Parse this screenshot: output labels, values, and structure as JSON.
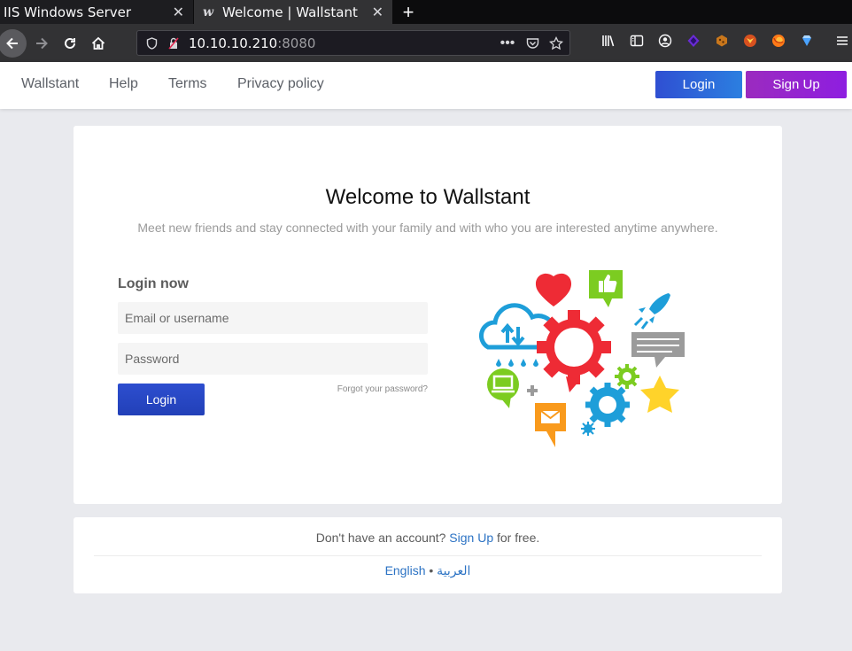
{
  "browser": {
    "tabs": [
      {
        "title": "IIS Windows Server",
        "favicon": ""
      },
      {
        "title": "Welcome | Wallstant",
        "favicon": "w"
      }
    ],
    "new_tab_label": "+",
    "url_host": "10.10.10.210",
    "url_port": ":8080",
    "toolbar_icons": [
      "library-icon",
      "sidebar-icon",
      "account-icon",
      "extension-purple-icon",
      "extension-cookie-icon",
      "extension-fox-icon",
      "firefox-icon",
      "extension-diamond-icon",
      "menu-icon"
    ]
  },
  "site": {
    "nav": [
      "Wallstant",
      "Help",
      "Terms",
      "Privacy policy"
    ],
    "login_label": "Login",
    "signup_label": "Sign Up",
    "login_gradient": [
      "#2f4fd2",
      "#2c7fe0"
    ],
    "signup_gradient": [
      "#9b2bbf",
      "#8e1ee0"
    ]
  },
  "main": {
    "title": "Welcome to Wallstant",
    "subtitle": "Meet new friends and stay connected with your family and with who you are interested anytime anywhere.",
    "login_heading": "Login now",
    "email_placeholder": "Email or username",
    "password_placeholder": "Password",
    "login_button": "Login",
    "forgot_link": "Forgot your password?"
  },
  "footer": {
    "prompt": "Don't have an account?",
    "signup_link": "Sign Up",
    "suffix": "for free.",
    "lang_english": "English",
    "lang_separator": "•",
    "lang_arabic": "العربية"
  }
}
